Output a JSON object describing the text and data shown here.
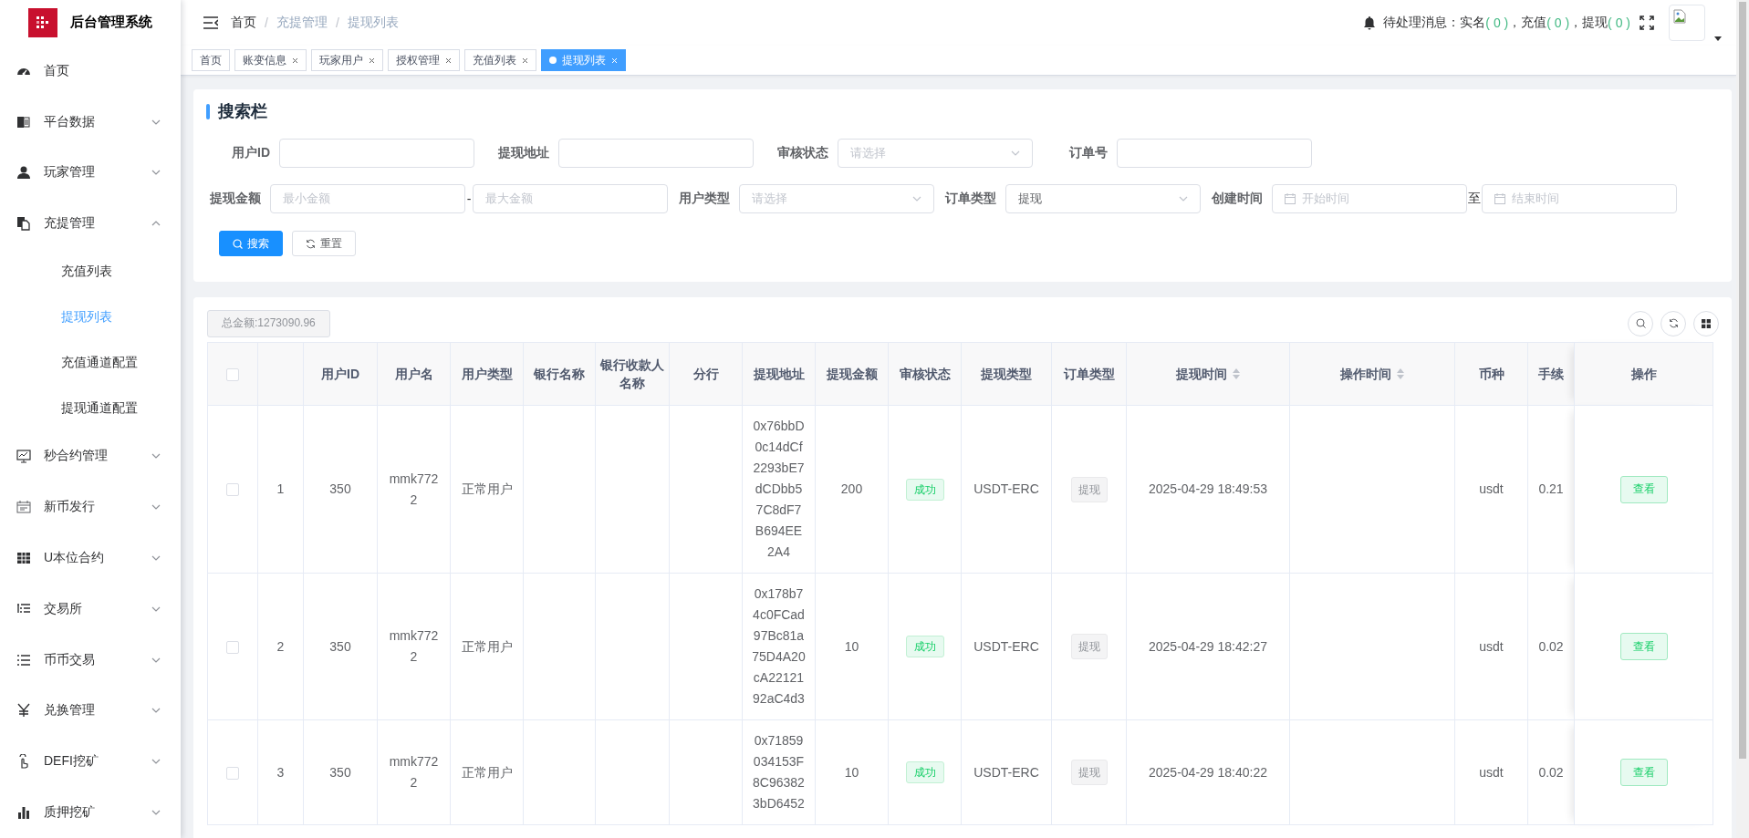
{
  "sidebar": {
    "title": "后台管理系统",
    "items": [
      {
        "label": "首页",
        "kind": "link",
        "selected": false
      },
      {
        "label": "平台数据",
        "kind": "menu",
        "expanded": false,
        "selected": false
      },
      {
        "label": "玩家管理",
        "kind": "menu",
        "expanded": false,
        "selected": false
      },
      {
        "label": "充提管理",
        "kind": "menu",
        "expanded": true,
        "selected": false,
        "children": [
          {
            "label": "充值列表",
            "selected": false
          },
          {
            "label": "提现列表",
            "selected": true
          },
          {
            "label": "充值通道配置",
            "selected": false
          },
          {
            "label": "提现通道配置",
            "selected": false
          }
        ]
      },
      {
        "label": "秒合约管理",
        "kind": "menu",
        "expanded": false,
        "selected": false
      },
      {
        "label": "新币发行",
        "kind": "menu",
        "expanded": false,
        "selected": false
      },
      {
        "label": "U本位合约",
        "kind": "menu",
        "expanded": false,
        "selected": false
      },
      {
        "label": "交易所",
        "kind": "menu",
        "expanded": false,
        "selected": false
      },
      {
        "label": "币币交易",
        "kind": "menu",
        "expanded": false,
        "selected": false
      },
      {
        "label": "兑换管理",
        "kind": "menu",
        "expanded": false,
        "selected": false
      },
      {
        "label": "DEFI挖矿",
        "kind": "menu",
        "expanded": false,
        "selected": false
      },
      {
        "label": "质押挖矿",
        "kind": "menu",
        "expanded": false,
        "selected": false
      }
    ]
  },
  "header": {
    "breadcrumb": [
      "首页",
      "充提管理",
      "提现列表"
    ],
    "breadcrumb_separator": "/",
    "notice": {
      "label": "待处理消息：",
      "counts": [
        {
          "label": "实名",
          "count": "( 0 )"
        },
        {
          "label": "，充值",
          "count": "( 0 )"
        },
        {
          "label": "，提现",
          "count": "( 0 )"
        }
      ]
    }
  },
  "tabs": [
    {
      "label": "首页",
      "closable": false,
      "selected": false
    },
    {
      "label": "账变信息",
      "closable": true,
      "selected": false
    },
    {
      "label": "玩家用户",
      "closable": true,
      "selected": false
    },
    {
      "label": "授权管理",
      "closable": true,
      "selected": false
    },
    {
      "label": "充值列表",
      "closable": true,
      "selected": false
    },
    {
      "label": "提现列表",
      "closable": true,
      "selected": true
    }
  ],
  "search": {
    "title": "搜索栏",
    "fields": [
      {
        "label": "用户ID",
        "kind": "text"
      },
      {
        "label": "提现地址",
        "kind": "text"
      },
      {
        "label": "审核状态",
        "kind": "select",
        "placeholder": "请选择"
      },
      {
        "label": "订单号",
        "kind": "text"
      },
      {
        "label": "提现金额",
        "kind": "range",
        "placeholder": "最小金额",
        "placeholder_end": "最大金额",
        "separator": "-"
      },
      {
        "label": "用户类型",
        "kind": "select",
        "placeholder": "请选择"
      },
      {
        "label": "订单类型",
        "kind": "select",
        "value": "提现"
      },
      {
        "label": "创建时间",
        "kind": "daterange",
        "placeholder": "开始时间",
        "placeholder_end": "结束时间",
        "separator": "至"
      }
    ],
    "buttons": [
      {
        "label": "搜索",
        "kind": "primary"
      },
      {
        "label": "重置",
        "kind": "default"
      }
    ]
  },
  "table": {
    "total": "总金额:1273090.96",
    "all_checked": false,
    "columns": [
      {
        "label": "用户ID",
        "sortable": false
      },
      {
        "label": "用户名",
        "sortable": false
      },
      {
        "label": "用户类型",
        "sortable": false
      },
      {
        "label": "银行名称",
        "sortable": false
      },
      {
        "label": "银行收款人名称",
        "sortable": false
      },
      {
        "label": "分行",
        "sortable": false
      },
      {
        "label": "提现地址",
        "sortable": false
      },
      {
        "label": "提现金额",
        "sortable": false
      },
      {
        "label": "审核状态",
        "sortable": false
      },
      {
        "label": "提现类型",
        "sortable": false
      },
      {
        "label": "订单类型",
        "sortable": false
      },
      {
        "label": "提现时间",
        "sortable": true
      },
      {
        "label": "操作时间",
        "sortable": true
      },
      {
        "label": "币种",
        "sortable": false
      },
      {
        "label": "手续",
        "sortable": false
      },
      {
        "label": "操作",
        "sortable": false
      }
    ],
    "rows": [
      {
        "checked": false,
        "index": "1",
        "user_id": "350",
        "username": "mmk7722",
        "user_type": "正常用户",
        "address": "0x76bbD0c14dCf2293bE7dCDbb57C8dF7B694EE2A4",
        "amount": "200",
        "status": "成功",
        "withdraw_type": "USDT-ERC",
        "order_type": "提现",
        "withdraw_time": "2025-04-29 18:49:53",
        "currency": "usdt",
        "fee": "0.21",
        "action": "查看"
      },
      {
        "checked": false,
        "index": "2",
        "user_id": "350",
        "username": "mmk7722",
        "user_type": "正常用户",
        "address": "0x178b74c0FCad97Bc81a75D4A20cA2212192aC4d3",
        "amount": "10",
        "status": "成功",
        "withdraw_type": "USDT-ERC",
        "order_type": "提现",
        "withdraw_time": "2025-04-29 18:42:27",
        "currency": "usdt",
        "fee": "0.02",
        "action": "查看"
      },
      {
        "checked": false,
        "index": "3",
        "user_id": "350",
        "username": "mmk7722",
        "user_type": "正常用户",
        "address": "0x71859034153F8C963823bD6452",
        "amount": "10",
        "status": "成功",
        "withdraw_type": "USDT-ERC",
        "order_type": "提现",
        "withdraw_time": "2025-04-29 18:40:22",
        "currency": "usdt",
        "fee": "0.02",
        "action": "查看"
      }
    ]
  }
}
